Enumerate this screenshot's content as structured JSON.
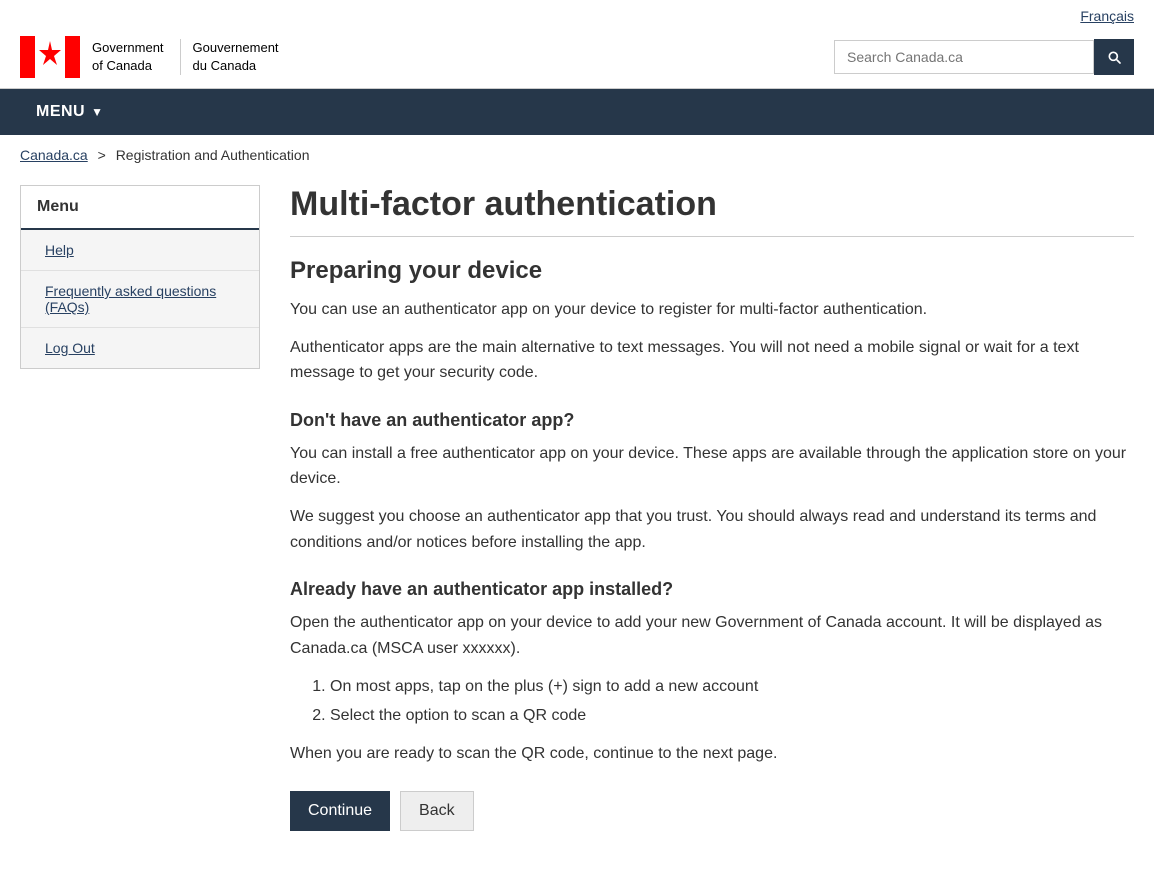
{
  "header": {
    "francais_label": "Français",
    "gov_name_en_line1": "Government",
    "gov_name_en_line2": "of Canada",
    "gov_name_fr_line1": "Gouvernement",
    "gov_name_fr_line2": "du Canada",
    "search_placeholder": "Search Canada.ca",
    "search_button_label": "Search"
  },
  "nav": {
    "menu_label": "MENU"
  },
  "breadcrumb": {
    "home_label": "Canada.ca",
    "separator": ">",
    "current": "Registration and Authentication"
  },
  "sidebar": {
    "menu_header": "Menu",
    "items": [
      {
        "label": "Help"
      },
      {
        "label": "Frequently asked questions (FAQs)"
      },
      {
        "label": "Log Out"
      }
    ]
  },
  "content": {
    "page_title": "Multi-factor authentication",
    "section1_title": "Preparing your device",
    "para1": "You can use an authenticator app on your device to register for multi-factor authentication.",
    "para2": "Authenticator apps are the main alternative to text messages. You will not need a mobile signal or wait for a text message to get your security code.",
    "subsection1_title": "Don't have an authenticator app?",
    "para3": "You can install a free authenticator app on your device. These apps are available through the application store on your device.",
    "para4": "We suggest you choose an authenticator app that you trust. You should always read and understand its terms and conditions and/or notices before installing the app.",
    "subsection2_title": "Already have an authenticator app installed?",
    "para5": "Open the authenticator app on your device to add your new Government of Canada account. It will be displayed as Canada.ca (MSCA user xxxxxx).",
    "list_items": [
      "On most apps, tap on the plus (+) sign to add a new account",
      "Select the option to scan a QR code"
    ],
    "para6": "When you are ready to scan the QR code, continue to the next page.",
    "continue_label": "Continue",
    "back_label": "Back"
  }
}
